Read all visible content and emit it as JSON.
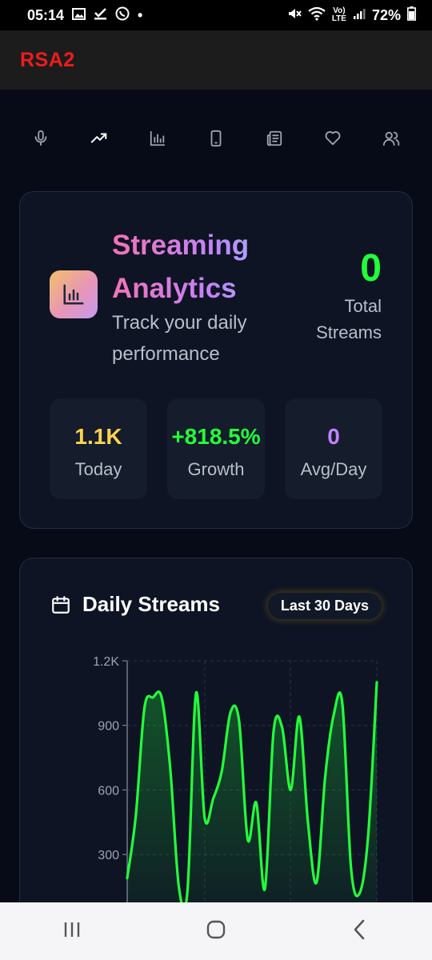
{
  "status_bar": {
    "time": "05:14",
    "dot": "•",
    "volte_top": "Vo)",
    "volte_bottom": "LTE",
    "battery": "72%"
  },
  "app": {
    "title": "RSA2"
  },
  "tabs": [
    {
      "icon": "mic-icon",
      "active": false
    },
    {
      "icon": "trending-up-icon",
      "active": true
    },
    {
      "icon": "bar-chart-icon",
      "active": false
    },
    {
      "icon": "phone-icon",
      "active": false
    },
    {
      "icon": "news-icon",
      "active": false
    },
    {
      "icon": "heart-icon",
      "active": false
    },
    {
      "icon": "users-icon",
      "active": false
    }
  ],
  "analytics": {
    "title_line1": "Streaming",
    "title_line2": "Analytics",
    "subtitle_line1": "Track your daily",
    "subtitle_line2": "performance",
    "total_value": "0",
    "total_label_line1": "Total",
    "total_label_line2": "Streams",
    "stats": [
      {
        "value": "1.1K",
        "label": "Today",
        "color": "#fcd34d"
      },
      {
        "value": "+818.5%",
        "label": "Growth",
        "color": "#22ff3a"
      },
      {
        "value": "0",
        "label": "Avg/Day",
        "color": "#c084fc"
      }
    ]
  },
  "daily": {
    "title": "Daily Streams",
    "range_label": "Last 30 Days"
  },
  "colors": {
    "accent_green": "#22ff3a",
    "brand_red": "#ee1c1c"
  },
  "chart_data": {
    "type": "area",
    "y_ticks": [
      "1.2K",
      "900",
      "600",
      "300"
    ],
    "ylim": [
      0,
      1200
    ],
    "grid": true,
    "values": [
      190,
      480,
      980,
      1030,
      1030,
      700,
      150,
      130,
      1050,
      470,
      560,
      690,
      960,
      920,
      370,
      540,
      140,
      870,
      890,
      600,
      940,
      450,
      170,
      660,
      950,
      1000,
      240,
      120,
      390,
      1100
    ]
  }
}
